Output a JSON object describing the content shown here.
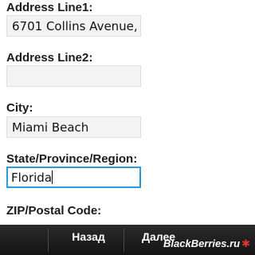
{
  "form": {
    "address1": {
      "label": "Address Line1:",
      "value": "6701 Collins Avenue,"
    },
    "address2": {
      "label": "Address Line2:",
      "value": ""
    },
    "city": {
      "label": "City:",
      "value": "Miami Beach"
    },
    "state": {
      "label": "State/Province/Region:",
      "value": "Florida"
    },
    "zip": {
      "label": "ZIP/Postal Code:"
    }
  },
  "toolbar": {
    "back_label": "Назад",
    "next_label": "Далее"
  },
  "watermark": {
    "text": "BlackBerries.ru",
    "icon": "star-icon"
  }
}
